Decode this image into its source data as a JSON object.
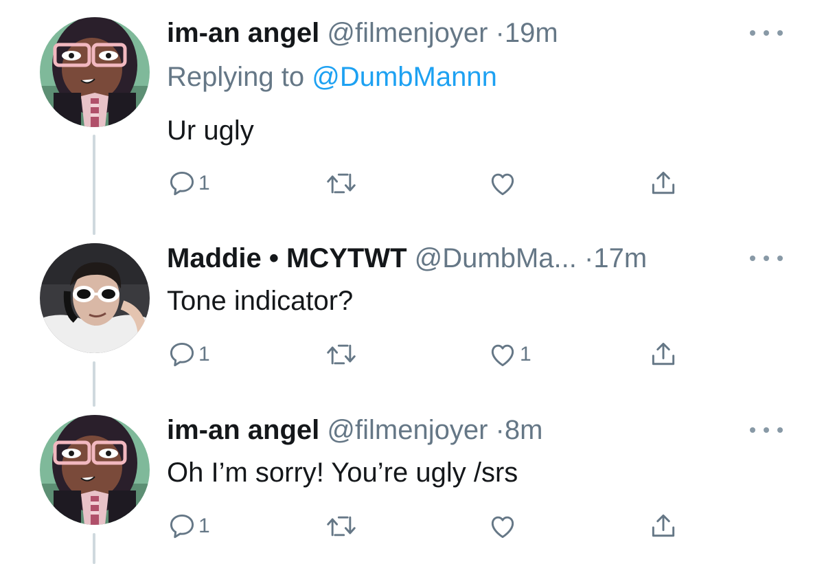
{
  "tweets": [
    {
      "name": "im-an angel",
      "handle": "@filmenjoyer",
      "dot": "·",
      "time": "19m",
      "replying_prefix": "Replying to",
      "replying_mention": "@DumbMannn",
      "text": "Ur ugly",
      "avatar": "cartoon-girl-avatar",
      "reply_count": "1",
      "retweet_count": "",
      "like_count": ""
    },
    {
      "name": "Maddie • MCYTWT",
      "handle": "@DumbMa...",
      "dot": "·",
      "time": "17m",
      "text": "Tone indicator?",
      "avatar": "person-sunglasses-avatar",
      "reply_count": "1",
      "retweet_count": "",
      "like_count": "1"
    },
    {
      "name": "im-an angel",
      "handle": "@filmenjoyer",
      "dot": "·",
      "time": "8m",
      "text": "Oh I’m sorry! You’re ugly /srs",
      "avatar": "cartoon-girl-avatar",
      "reply_count": "1",
      "retweet_count": "",
      "like_count": ""
    }
  ],
  "colors": {
    "name": "#14171a",
    "secondary": "#657786",
    "mention": "#1da1f2",
    "thread_line": "#cfd9de",
    "more_dots": "#8899a6"
  },
  "icons": [
    "more-icon",
    "reply-icon",
    "retweet-icon",
    "like-icon",
    "share-icon"
  ]
}
